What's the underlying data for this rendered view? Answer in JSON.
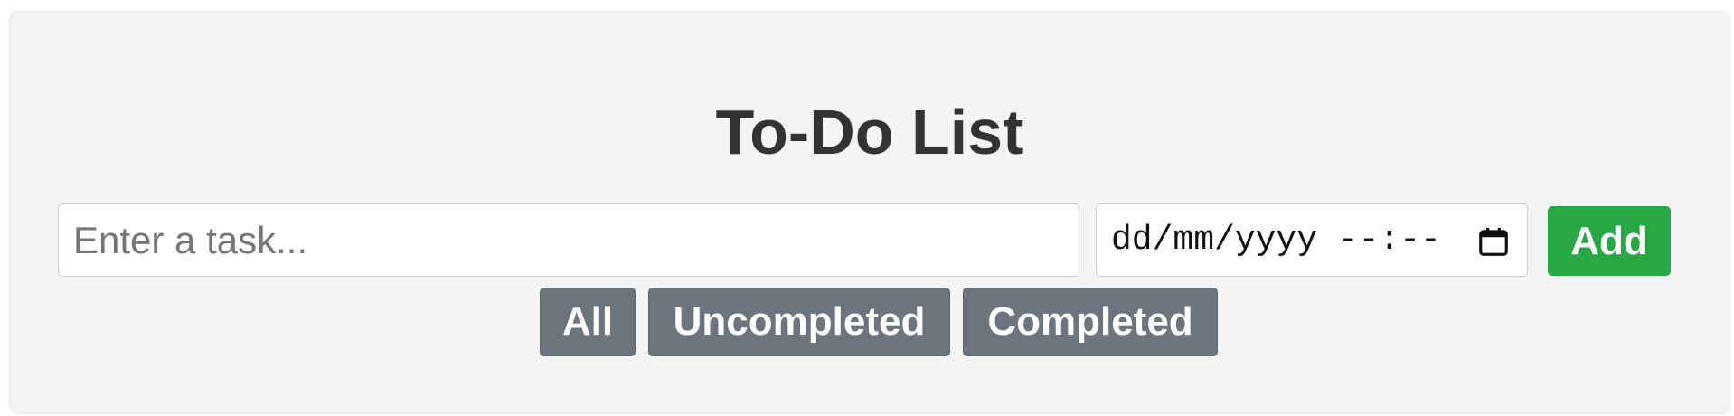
{
  "app": {
    "title": "To-Do List"
  },
  "task_input": {
    "placeholder": "Enter a task...",
    "value": ""
  },
  "due_date": {
    "display": "dd/mm/yyyy --:--",
    "icon": "calendar-icon"
  },
  "actions": {
    "add_label": "Add"
  },
  "filters": [
    {
      "label": "All"
    },
    {
      "label": "Uncompleted"
    },
    {
      "label": "Completed"
    }
  ],
  "colors": {
    "card_background": "#f4f4f4",
    "title": "#333333",
    "add_button": "#28a745",
    "filter_button": "#6c757d"
  }
}
